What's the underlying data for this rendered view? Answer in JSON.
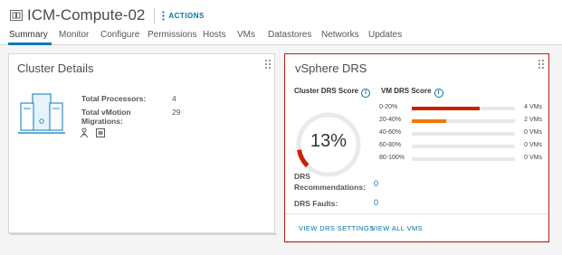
{
  "header": {
    "title": "ICM-Compute-02",
    "actions_label": "ACTIONS"
  },
  "tabs": [
    {
      "label": "Summary",
      "active": true
    },
    {
      "label": "Monitor"
    },
    {
      "label": "Configure"
    },
    {
      "label": "Permissions"
    },
    {
      "label": "Hosts"
    },
    {
      "label": "VMs"
    },
    {
      "label": "Datastores"
    },
    {
      "label": "Networks"
    },
    {
      "label": "Updates"
    }
  ],
  "cluster_details": {
    "title": "Cluster Details",
    "total_processors_label": "Total Processors:",
    "total_processors_value": "4",
    "total_vmotion_label": "Total vMotion Migrations:",
    "total_vmotion_value": "29"
  },
  "drs": {
    "title": "vSphere DRS",
    "cluster_score_label": "Cluster DRS Score",
    "cluster_score_value": "13%",
    "cluster_score_fraction": 0.13,
    "vm_score_label": "VM DRS Score",
    "histogram": [
      {
        "range": "0-20%",
        "count": "4 VMs",
        "fraction": 0.66,
        "color": "#c92100"
      },
      {
        "range": "20-40%",
        "count": "2 VMs",
        "fraction": 0.33,
        "color": "#f57600"
      },
      {
        "range": "40-60%",
        "count": "0 VMs",
        "fraction": 0,
        "color": "#e8e8e8"
      },
      {
        "range": "60-80%",
        "count": "0 VMs",
        "fraction": 0,
        "color": "#e8e8e8"
      },
      {
        "range": "80-100%",
        "count": "0 VMs",
        "fraction": 0,
        "color": "#e8e8e8"
      }
    ],
    "recommendations_label": "DRS Recommendations:",
    "recommendations_value": "0",
    "faults_label": "DRS Faults:",
    "faults_value": "0",
    "view_settings_link": "VIEW DRS SETTINGS",
    "view_vms_link": "VIEW ALL VMS"
  },
  "colors": {
    "accent": "#0072a3",
    "gauge_red": "#c92100",
    "highlight_border": "#c21d0f"
  }
}
